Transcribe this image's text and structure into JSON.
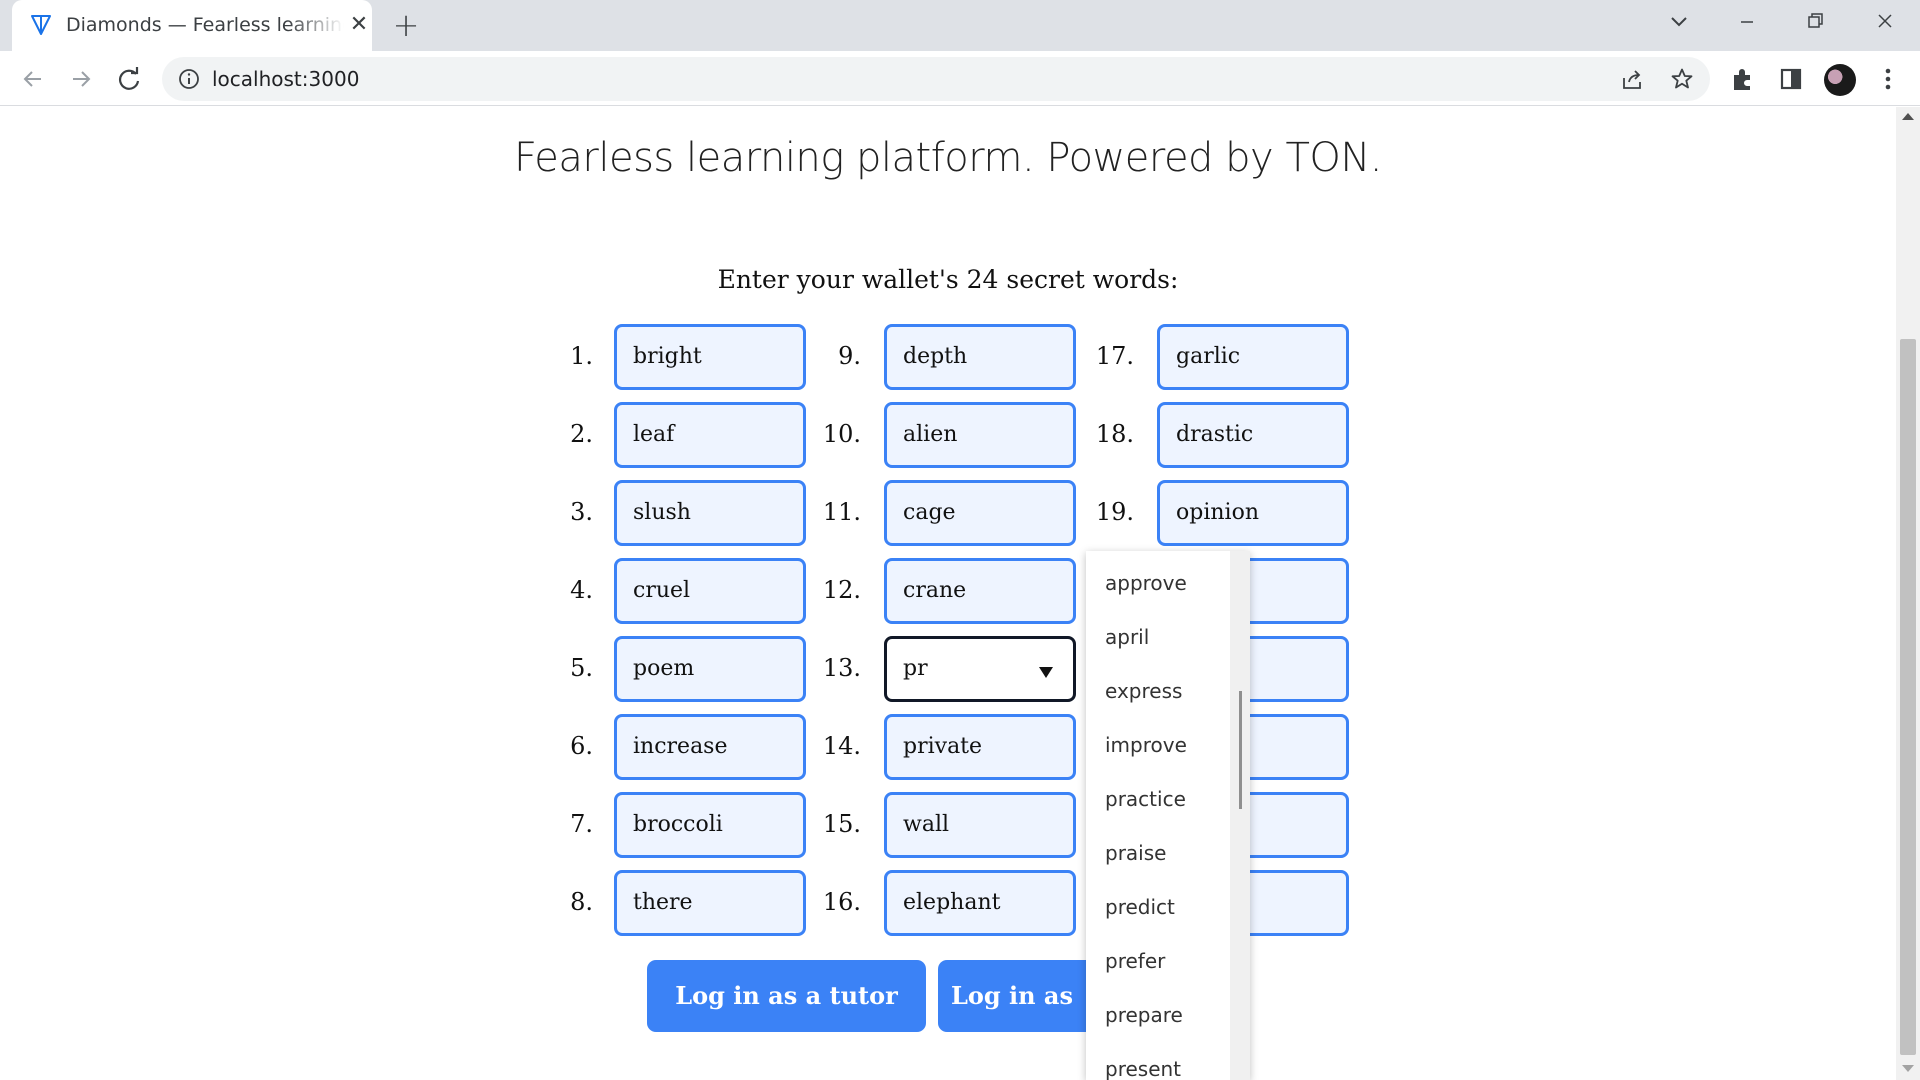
{
  "browser": {
    "tab_title": "Diamonds — Fearless learning platform",
    "url": "localhost:3000"
  },
  "page": {
    "headline": "Fearless learning platform. Powered by TON.",
    "prompt": "Enter your wallet's 24 secret words:",
    "words": [
      {
        "num": "1.",
        "value": "bright"
      },
      {
        "num": "2.",
        "value": "leaf"
      },
      {
        "num": "3.",
        "value": "slush"
      },
      {
        "num": "4.",
        "value": "cruel"
      },
      {
        "num": "5.",
        "value": "poem"
      },
      {
        "num": "6.",
        "value": "increase"
      },
      {
        "num": "7.",
        "value": "broccoli"
      },
      {
        "num": "8.",
        "value": "there"
      },
      {
        "num": "9.",
        "value": "depth"
      },
      {
        "num": "10.",
        "value": "alien"
      },
      {
        "num": "11.",
        "value": "cage"
      },
      {
        "num": "12.",
        "value": "crane"
      },
      {
        "num": "13.",
        "value": "pr"
      },
      {
        "num": "14.",
        "value": "private"
      },
      {
        "num": "15.",
        "value": "wall"
      },
      {
        "num": "16.",
        "value": "elephant"
      },
      {
        "num": "17.",
        "value": "garlic"
      },
      {
        "num": "18.",
        "value": "drastic"
      },
      {
        "num": "19.",
        "value": "opinion"
      },
      {
        "num": "",
        "value": ""
      },
      {
        "num": "",
        "value": ""
      },
      {
        "num": "",
        "value": ""
      },
      {
        "num": "",
        "value": ""
      },
      {
        "num": "",
        "value": ""
      }
    ],
    "buttons": {
      "tutor": "Log in as a tutor",
      "student": "Log in as"
    },
    "suggestions": [
      "approve",
      "april",
      "express",
      "improve",
      "practice",
      "praise",
      "predict",
      "prefer",
      "prepare",
      "present"
    ]
  },
  "colors": {
    "accent": "#3b82f6",
    "input_bg": "#eef4ff"
  }
}
